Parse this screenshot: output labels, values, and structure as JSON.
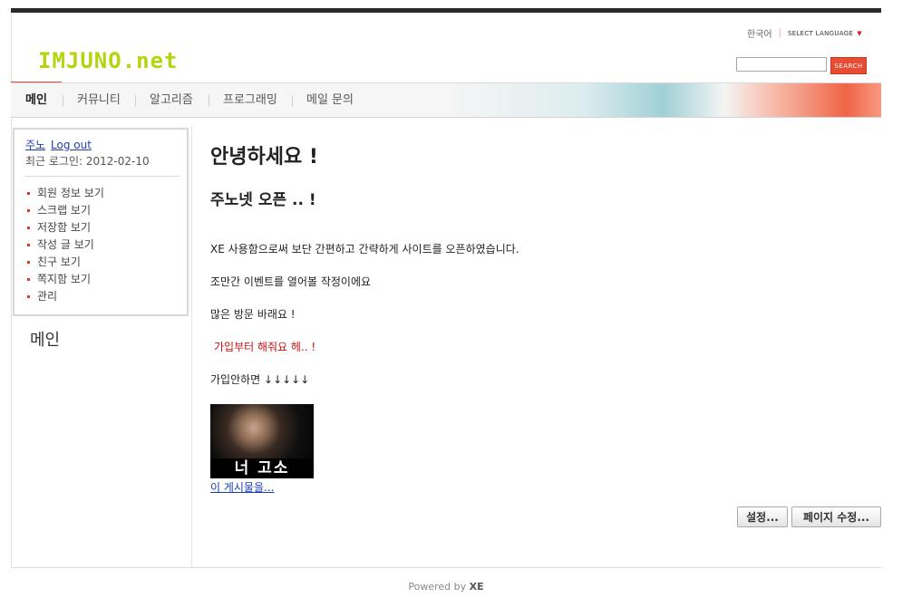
{
  "header": {
    "logo": "IMJUNO.net",
    "language_current": "한국어",
    "language_select": "SELECT LANGUAGE",
    "search_button": "SEARCH",
    "search_value": ""
  },
  "nav": {
    "items": [
      {
        "label": "메인",
        "active": true
      },
      {
        "label": "커뮤니티"
      },
      {
        "label": "알고리즘"
      },
      {
        "label": "프로그래밍"
      },
      {
        "label": "메일 문의"
      }
    ]
  },
  "sidebar": {
    "user_name": "주노",
    "logout": "Log out",
    "last_login": "최근 로그인: 2012-02-10",
    "menu": [
      "회원 정보 보기",
      "스크랩 보기",
      "저장함 보기",
      "작성 글 보기",
      "친구 보기",
      "쪽지함 보기",
      "관리"
    ],
    "section_title": "메인"
  },
  "content": {
    "title": "안녕하세요 !",
    "subtitle": "주노넷 오픈 .. !",
    "paragraphs": [
      "XE 사용함으로써 보단 간편하고 간략하게 사이트를 오픈하였습니다.",
      "조만간 이벤트를 열어볼 작정이에요",
      "많은 방문 바래요 !",
      "가입부터 해줘요 헤.. !",
      "가입안하면 ↓↓↓↓↓"
    ],
    "image_caption": "너 고소",
    "post_link": "이 게시물을..."
  },
  "actions": {
    "settings": "설정...",
    "edit_page": "페이지 수정..."
  },
  "footer": {
    "powered_by": "Powered by",
    "brand": "XE"
  },
  "colors": {
    "accent_red": "#e84c32",
    "logo_green": "#b6d40e",
    "link_blue": "#1c3db0"
  }
}
